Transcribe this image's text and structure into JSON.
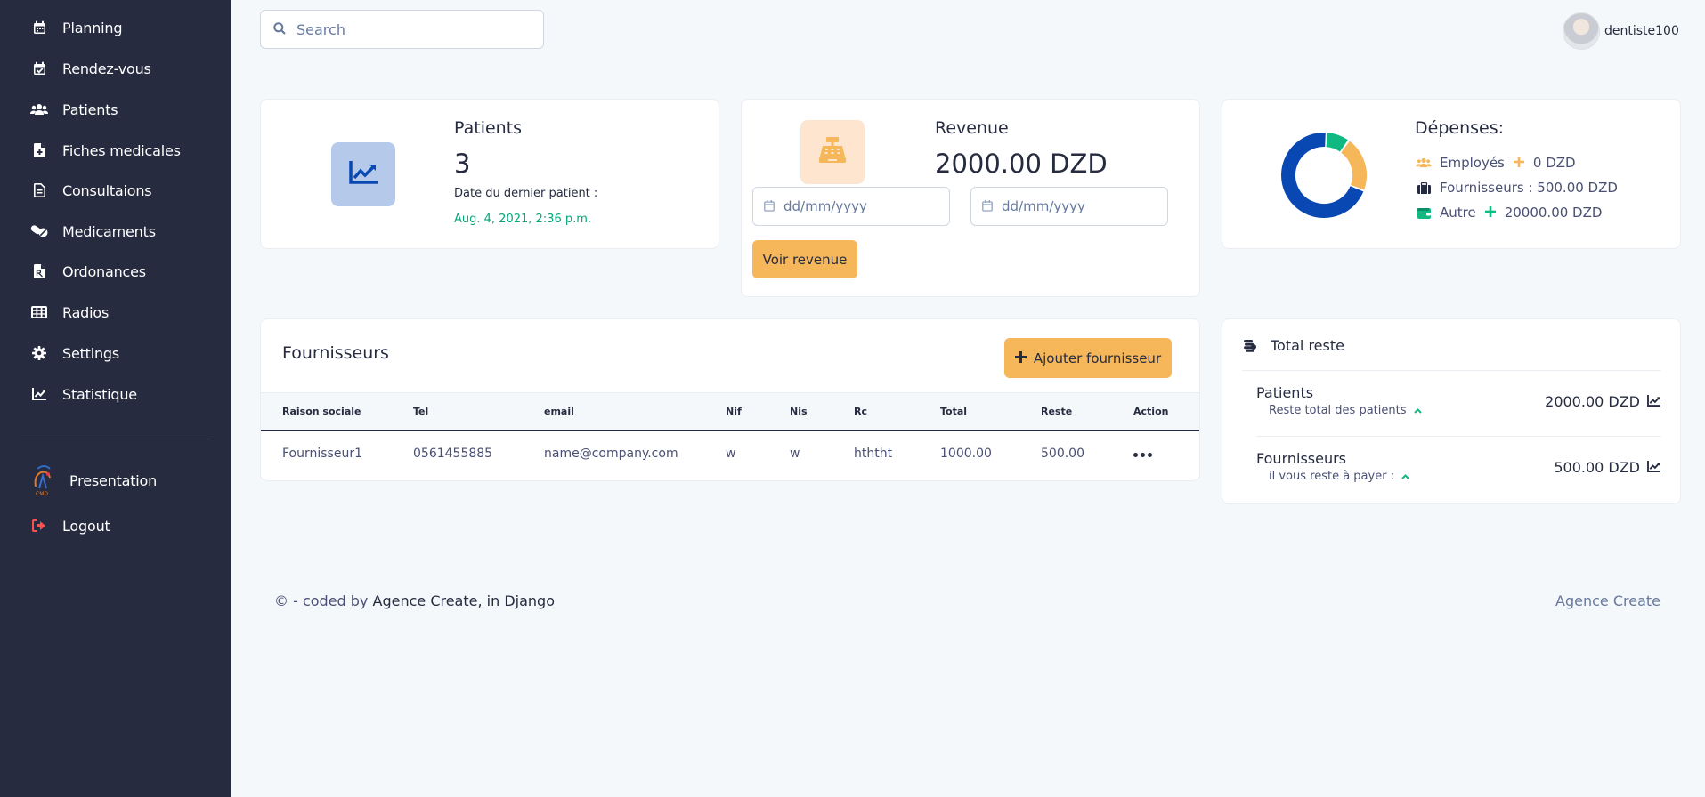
{
  "sidebar": {
    "items": [
      {
        "label": "Planning",
        "icon": "calendar-icon"
      },
      {
        "label": "Rendez-vous",
        "icon": "calendar-check-icon"
      },
      {
        "label": "Patients",
        "icon": "users-icon"
      },
      {
        "label": "Fiches medicales",
        "icon": "file-medical-icon"
      },
      {
        "label": "Consultaions",
        "icon": "file-text-icon"
      },
      {
        "label": "Medicaments",
        "icon": "pills-icon"
      },
      {
        "label": "Ordonances",
        "icon": "file-prescription-icon"
      },
      {
        "label": "Radios",
        "icon": "grid-icon"
      },
      {
        "label": "Settings",
        "icon": "gear-icon"
      },
      {
        "label": "Statistique",
        "icon": "chart-line-icon"
      }
    ],
    "presentation": "Presentation",
    "logout": "Logout"
  },
  "search": {
    "placeholder": "Search"
  },
  "user": {
    "name": "dentiste100"
  },
  "patients_card": {
    "title": "Patients",
    "count": "3",
    "last_label": "Date du dernier patient :",
    "last_date": "Aug. 4, 2021, 2:36 p.m."
  },
  "revenue_card": {
    "title": "Revenue",
    "amount": "2000.00 DZD",
    "date_placeholder_1": "dd/mm/yyyy",
    "date_placeholder_2": "dd/mm/yyyy",
    "button": "Voir revenue"
  },
  "depenses_card": {
    "title": "Dépenses:",
    "employes_label": "Employés",
    "employes_value": "0 DZD",
    "fournisseurs": "Fournisseurs : 500.00 DZD",
    "autre_label": "Autre",
    "autre_value": "20000.00 DZD"
  },
  "chart_data": {
    "type": "pie",
    "categories": [
      "Employés",
      "Fournisseurs",
      "Autre"
    ],
    "values": [
      0,
      500,
      20000
    ],
    "display_fractions": [
      0.09,
      0.21,
      0.7
    ],
    "colors": [
      "#10b981",
      "#f5b759",
      "#0948b3"
    ]
  },
  "fournisseurs": {
    "title": "Fournisseurs",
    "add_button": "Ajouter fournisseur",
    "columns": [
      "Raison sociale",
      "Tel",
      "email",
      "Nif",
      "Nis",
      "Rc",
      "Total",
      "Reste",
      "Action"
    ],
    "rows": [
      [
        "Fournisseur1",
        "0561455885",
        "name@company.com",
        "w",
        "w",
        "hththt",
        "1000.00",
        "500.00"
      ]
    ]
  },
  "total_reste": {
    "title": "Total reste",
    "patients_title": "Patients",
    "patients_sub": "Reste total des patients",
    "patients_value": "2000.00 DZD",
    "fournisseurs_title": "Fournisseurs",
    "fournisseurs_sub": "il vous reste à payer :",
    "fournisseurs_value": "500.00 DZD"
  },
  "footer": {
    "prefix": "© - coded by",
    "agency": "Agence Create, in Django",
    "right": "Agence Create"
  }
}
